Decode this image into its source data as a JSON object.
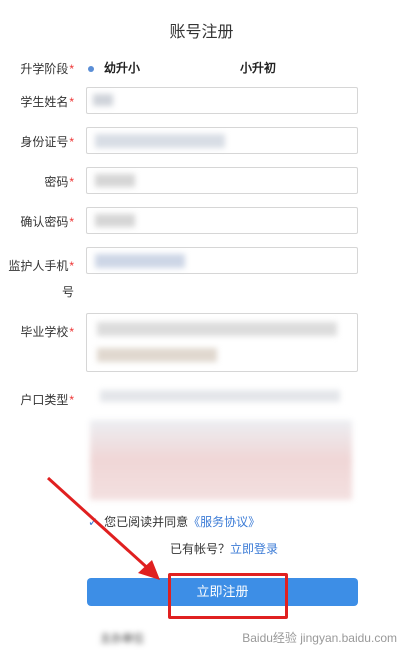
{
  "page": {
    "title": "账号注册"
  },
  "form": {
    "stage_label": "升学阶段",
    "stage_options": [
      "幼升小",
      "小升初"
    ],
    "student_name_label": "学生姓名",
    "id_card_label": "身份证号",
    "password_label": "密码",
    "confirm_password_label": "确认密码",
    "guardian_phone_label_line1": "监护人手机",
    "guardian_phone_label_line2": "号",
    "school_label": "毕业学校",
    "hukou_label": "户口类型",
    "required_mark": "*"
  },
  "agreement": {
    "text": "您已阅读并同意",
    "link": "《服务协议》"
  },
  "login": {
    "text": "已有帐号？",
    "link": "立即登录"
  },
  "submit_label": "立即注册",
  "footer_partial": "主办单位",
  "watermark": "Baidu经验 jingyan.baidu.com",
  "colors": {
    "accent": "#3d8ee6",
    "required": "#e33333",
    "highlight_box": "#e02020",
    "arrow": "#e02020"
  }
}
